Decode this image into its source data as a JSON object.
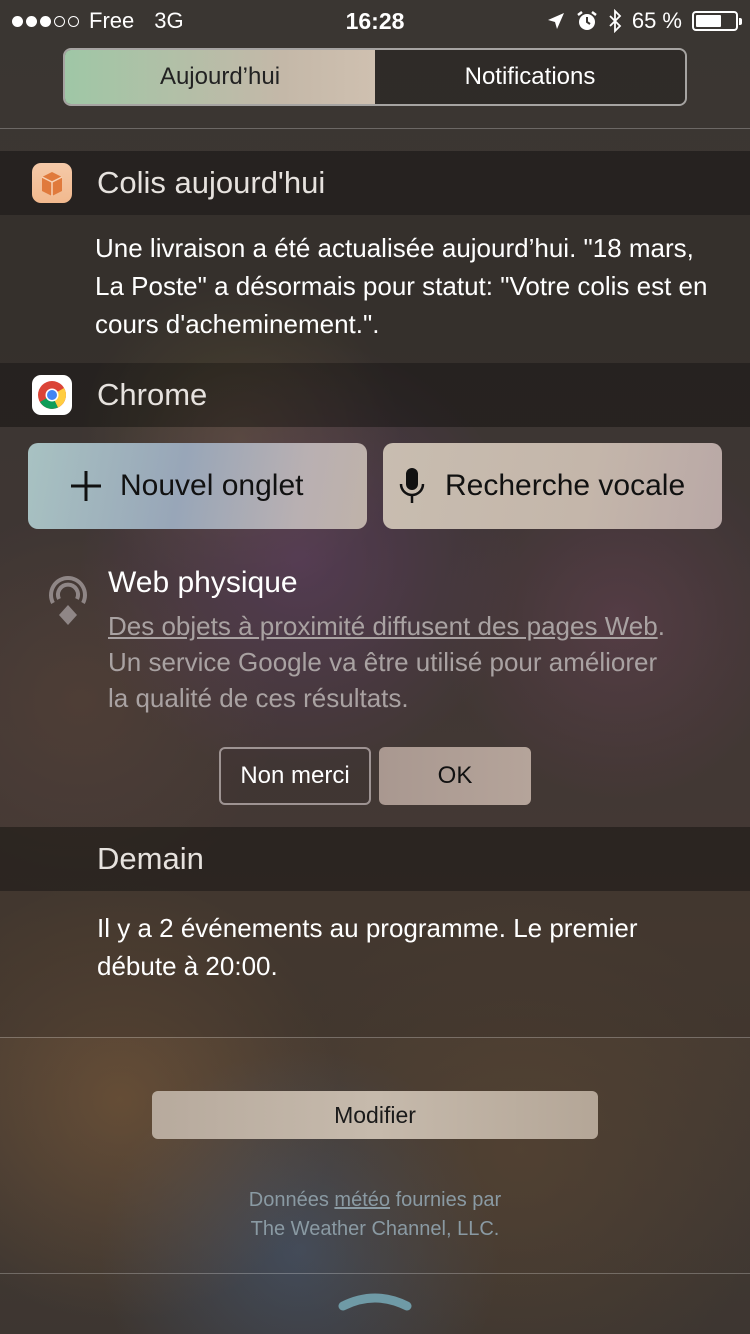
{
  "status_bar": {
    "carrier": "Free",
    "network": "3G",
    "time": "16:28",
    "battery": "65 %",
    "battery_level": 0.65
  },
  "tabs": {
    "today": "Aujourd’hui",
    "notifications": "Notifications"
  },
  "colis": {
    "title": "Colis aujourd'hui",
    "body": "Une livraison a été actualisée aujourd’hui. \"18 mars, La Poste\" a désormais pour statut: \"Votre colis est en cours d'acheminement.\"."
  },
  "chrome": {
    "title": "Chrome",
    "new_tab": "Nouvel onglet",
    "voice_search": "Recherche vocale",
    "physical_web": {
      "title": "Web physique",
      "link": "Des objets à proximité diffusent des pages Web",
      "text": ". Un service Google va être utilisé pour améliorer la qualité de ces résultats.",
      "decline": "Non merci",
      "accept": "OK"
    }
  },
  "tomorrow": {
    "title": "Demain",
    "body": "Il y a 2 événements au programme. Le premier débute à 20:00."
  },
  "edit_button": "Modifier",
  "weather_credit": {
    "prefix": "Données ",
    "link": "météo",
    "suffix": " fournies par",
    "line2": "The Weather Channel, LLC."
  },
  "colors": {
    "segment_active": "#9fc7a6",
    "credit_text": "#8a9aa3",
    "handle": "#6f9aa6"
  }
}
